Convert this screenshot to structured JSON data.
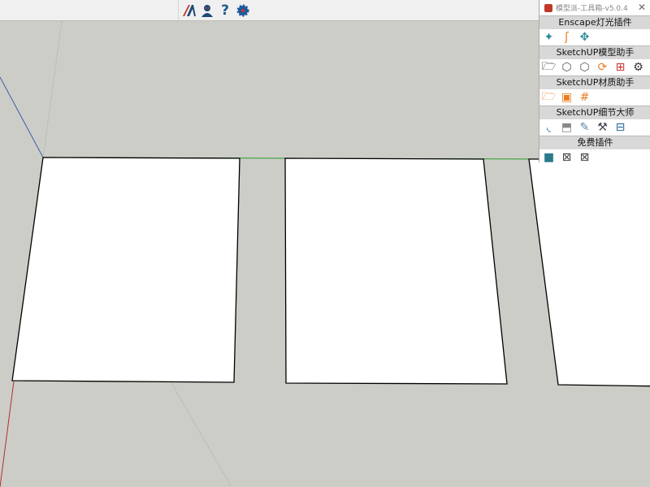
{
  "toolbar": {
    "icons": [
      "m-logo-icon",
      "user-icon",
      "help-icon",
      "settings-icon"
    ],
    "help_glyph": "?"
  },
  "panel": {
    "title": "模型派-工具箱-v5.0.4",
    "close": "✕",
    "sections": [
      {
        "label": "Enscape灯光插件",
        "icons": [
          "spotlight-icon",
          "light-arm-icon",
          "move-light-icon"
        ]
      },
      {
        "label": "SketchUP模型助手",
        "icons": [
          "open-folder-icon",
          "model-image-icon",
          "model-image-alt-icon",
          "refresh-image-icon",
          "toolbox-icon",
          "settings-icon"
        ]
      },
      {
        "label": "SketchUP材质助手",
        "icons": [
          "material-folder-icon",
          "material-frame-icon",
          "material-grid-icon"
        ]
      },
      {
        "label": "SketchUP细节大师",
        "icons": [
          "curve-icon",
          "extrude-icon",
          "pencil-icon",
          "hammer-icon",
          "toolbox-icon"
        ]
      },
      {
        "label": "免费插件",
        "icons": [
          "window-icon",
          "export-icon",
          "export-alt-icon"
        ]
      }
    ]
  },
  "colors": {
    "viewport": "#cdcdc8",
    "accent": "#e67e22",
    "teal": "#2a8a9a"
  }
}
